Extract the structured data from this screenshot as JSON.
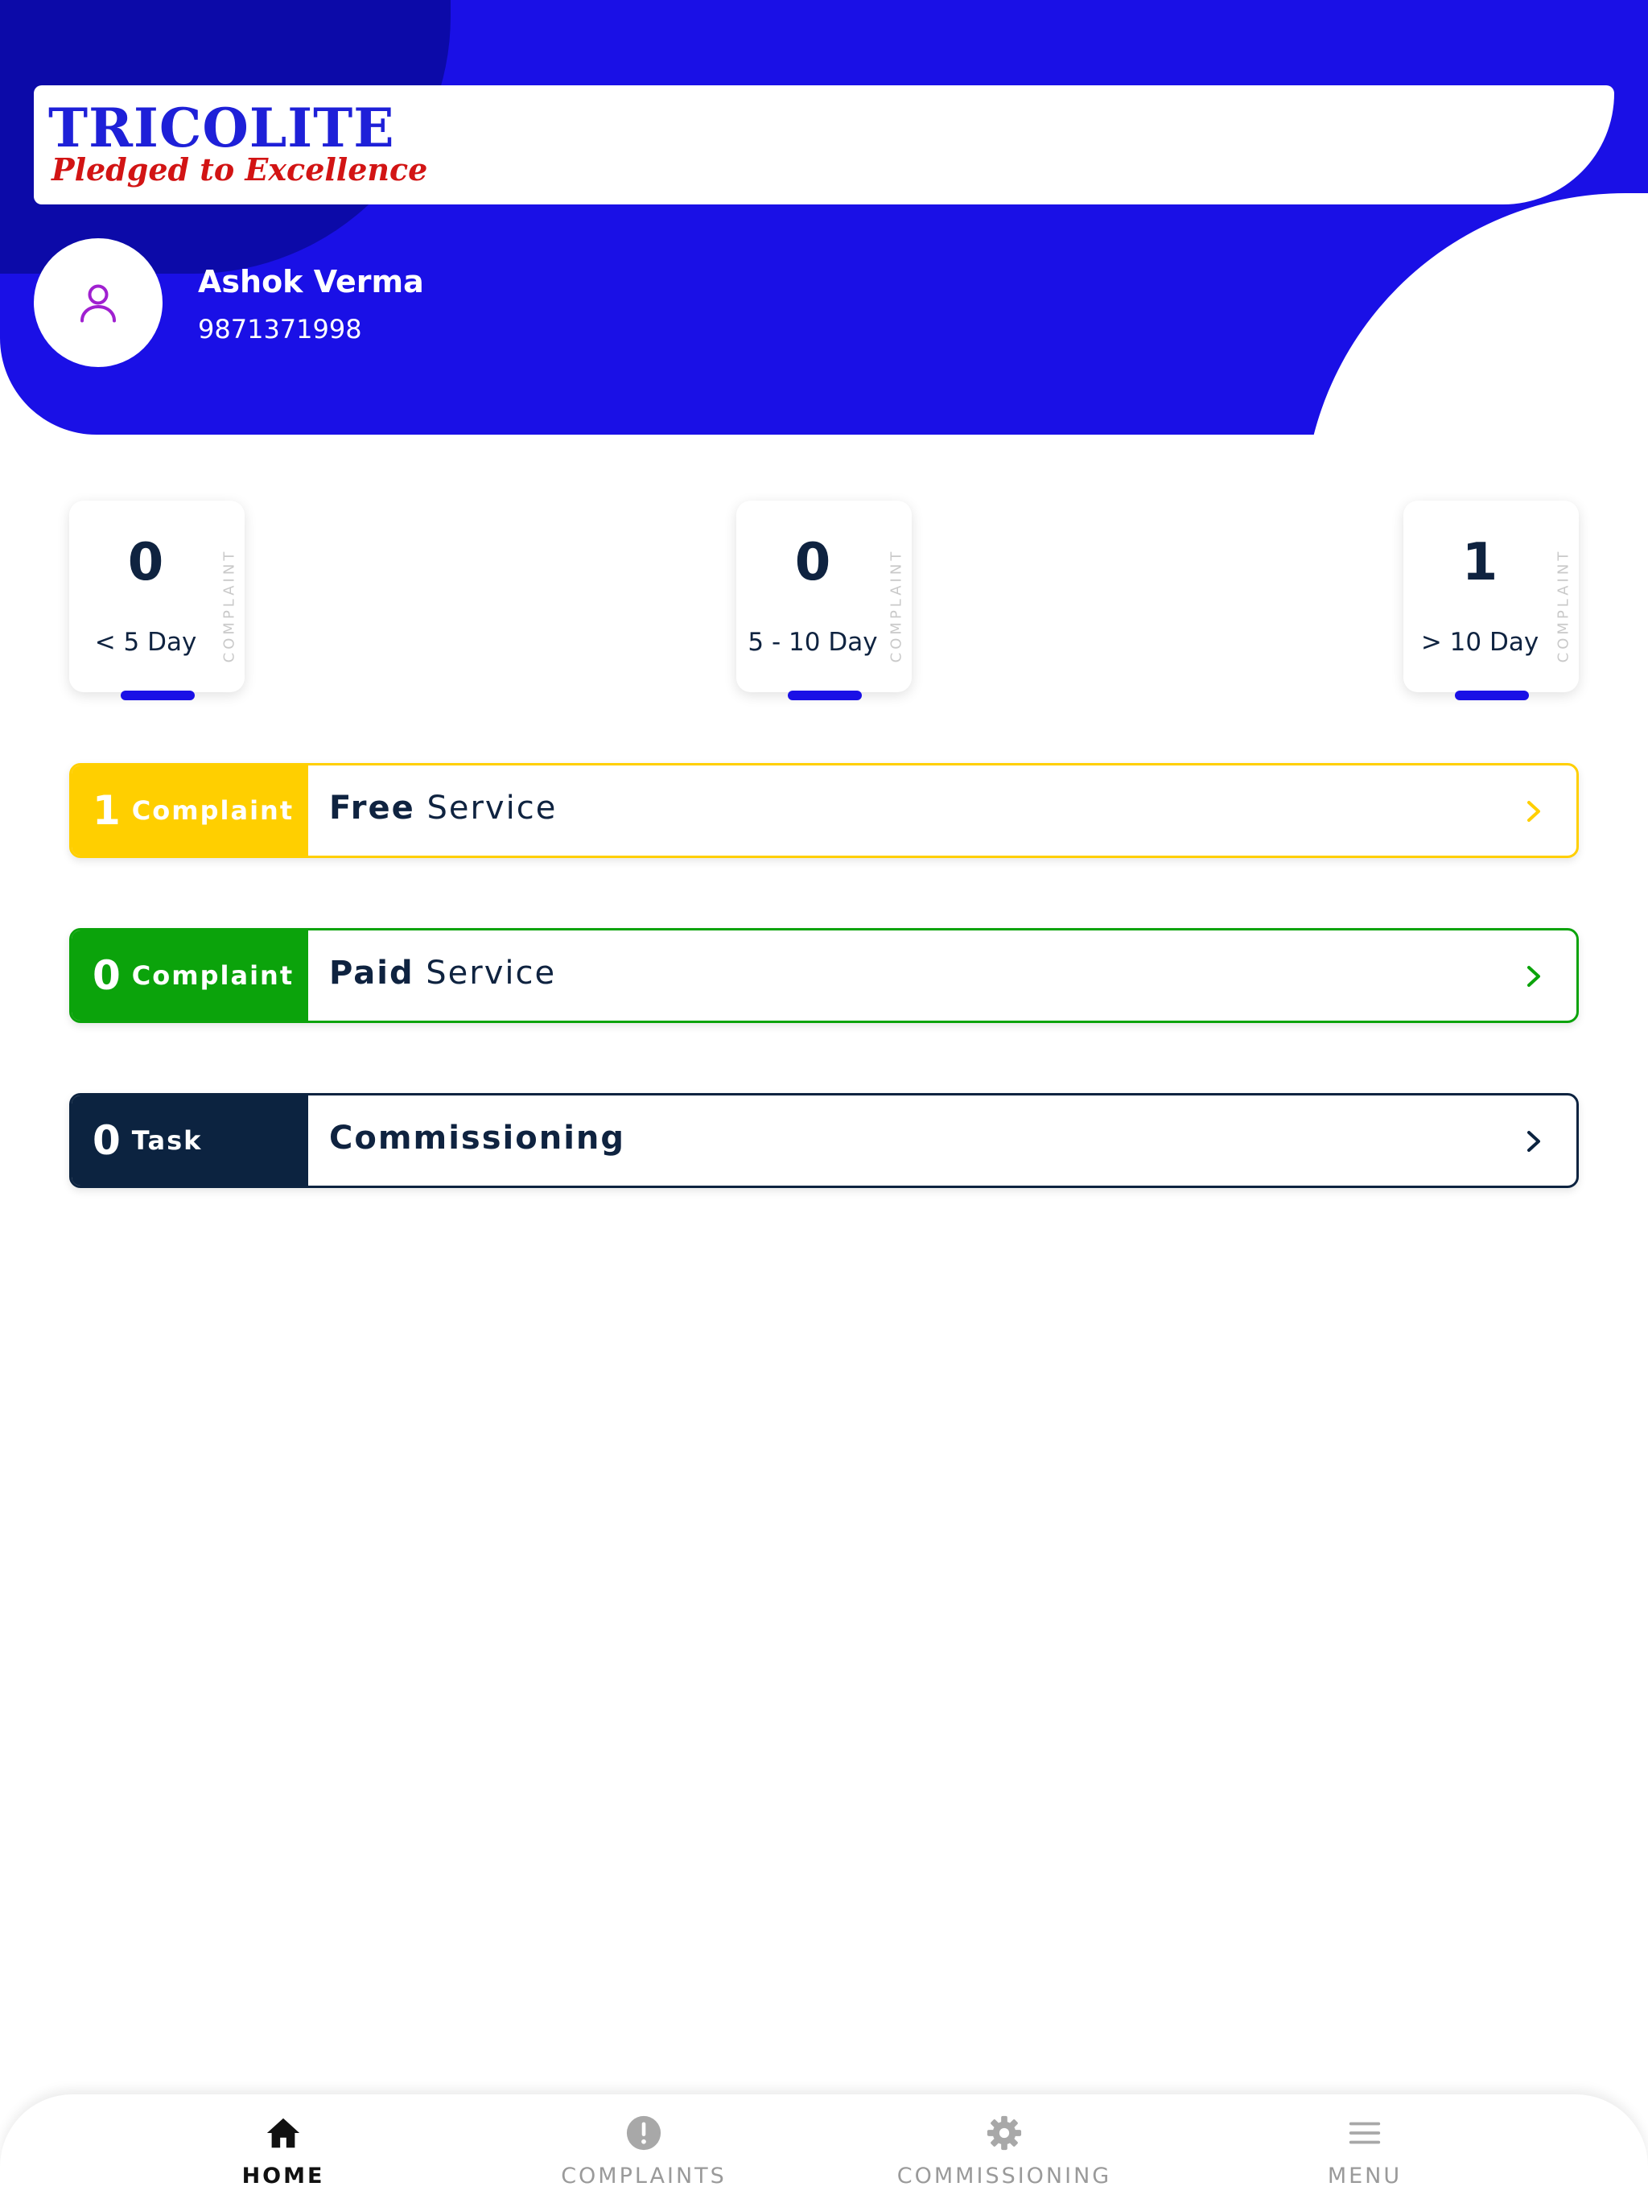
{
  "header": {
    "logo_title": "TRICOLITE",
    "logo_tagline": "Pledged to Excellence",
    "user_name": "Ashok Verma",
    "user_phone": "9871371998"
  },
  "stats": [
    {
      "value": "0",
      "label": "< 5 Day",
      "side_label": "COMPLAINT"
    },
    {
      "value": "0",
      "label": "5 - 10 Day",
      "side_label": "COMPLAINT"
    },
    {
      "value": "1",
      "label": "> 10 Day",
      "side_label": "COMPLAINT"
    }
  ],
  "rows": [
    {
      "count": "1",
      "badge_label": "Complaint",
      "title_bold": "Free",
      "title_rest": " Service",
      "color": "#ffcf00"
    },
    {
      "count": "0",
      "badge_label": "Complaint",
      "title_bold": "Paid",
      "title_rest": " Service",
      "color": "#0ba30b"
    },
    {
      "count": "0",
      "badge_label": "Task",
      "title_bold": "Commissioning",
      "title_rest": "",
      "color": "#0c2340"
    }
  ],
  "nav": [
    {
      "label": "HOME",
      "icon": "home-icon",
      "active": true
    },
    {
      "label": "COMPLAINTS",
      "icon": "alert-icon",
      "active": false
    },
    {
      "label": "COMMISSIONING",
      "icon": "gear-icon",
      "active": false
    },
    {
      "label": "MENU",
      "icon": "menu-icon",
      "active": false
    }
  ],
  "colors": {
    "header_blue": "#1a10e6",
    "header_dark_blue": "#0c0aa8",
    "logo_blue": "#1e20d8",
    "logo_red": "#d21414",
    "avatar_purple": "#a020d0"
  }
}
